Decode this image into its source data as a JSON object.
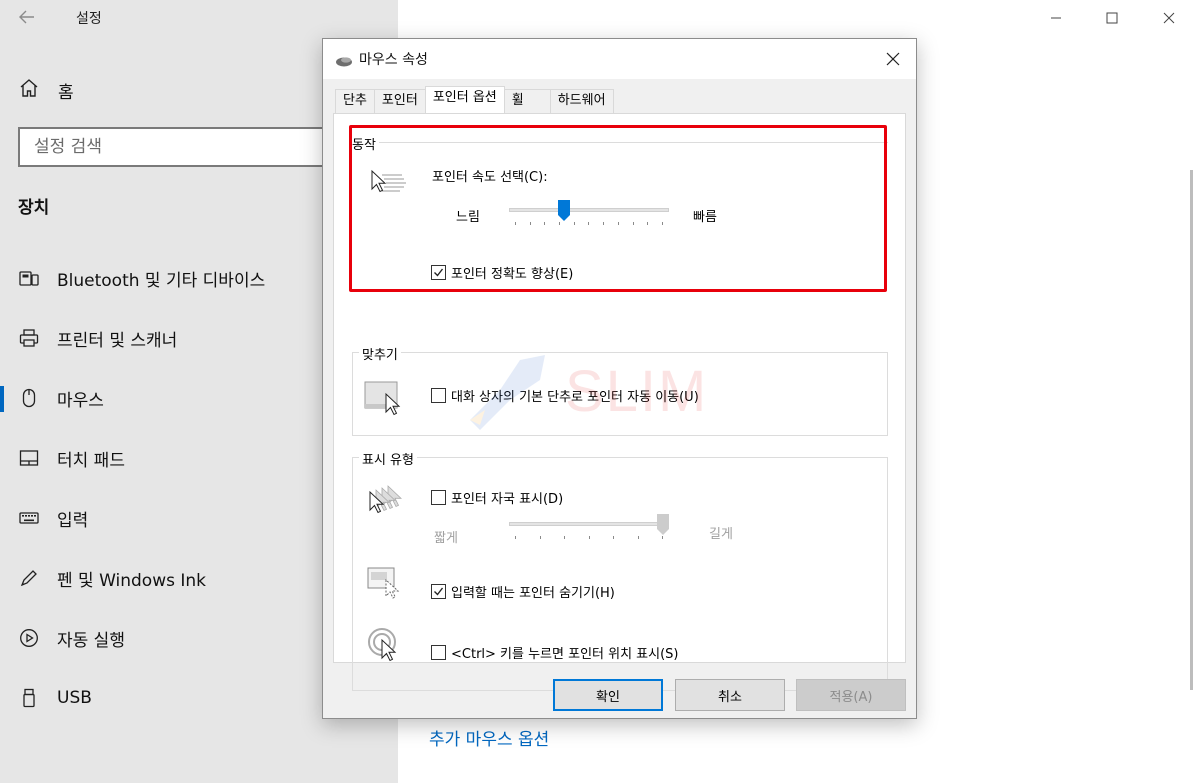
{
  "settings": {
    "title": "설정",
    "home_label": "홈",
    "search_placeholder": "설정 검색",
    "section": "장치",
    "nav": [
      {
        "label": "Bluetooth 및 기타 디바이스",
        "icon": "bluetooth-devices-icon"
      },
      {
        "label": "프린터 및 스캐너",
        "icon": "printer-icon"
      },
      {
        "label": "마우스",
        "icon": "mouse-icon",
        "selected": true
      },
      {
        "label": "터치 패드",
        "icon": "touchpad-icon"
      },
      {
        "label": "입력",
        "icon": "keyboard-icon"
      },
      {
        "label": "펜 및 Windows Ink",
        "icon": "pen-icon"
      },
      {
        "label": "자동 실행",
        "icon": "autoplay-icon"
      },
      {
        "label": "USB",
        "icon": "usb-icon"
      }
    ],
    "extra_link": "추가 마우스 옵션"
  },
  "dialog": {
    "title": "마우스 속성",
    "tabs": [
      "단추",
      "포인터",
      "포인터 옵션",
      "휠",
      "하드웨어"
    ],
    "active_tab": "포인터 옵션",
    "motion": {
      "title": "동작",
      "speed_label": "포인터 속도 선택(C):",
      "slow": "느림",
      "fast": "빠름",
      "speed_position_fraction": 0.33,
      "enhance_precision_label": "포인터 정확도 향상(E)",
      "enhance_precision_checked": true
    },
    "snap": {
      "title": "맞추기",
      "snap_label": "대화 상자의 기본 단추로 포인터 자동 이동(U)",
      "snap_checked": false
    },
    "visibility": {
      "title": "표시 유형",
      "trails_label": "포인터 자국 표시(D)",
      "trails_checked": false,
      "short": "짧게",
      "long": "길게",
      "trails_position_fraction": 1.0,
      "hide_typing_label": "입력할 때는 포인터 숨기기(H)",
      "hide_typing_checked": true,
      "ctrl_label": "<Ctrl> 키를 누르면 포인터 위치 표시(S)",
      "ctrl_checked": false
    },
    "buttons": {
      "ok": "확인",
      "cancel": "취소",
      "apply": "적용(A)"
    }
  },
  "watermark": "SLIM",
  "colors": {
    "accent": "#0078d7",
    "highlight": "#e8000b",
    "link": "#0067c0"
  }
}
